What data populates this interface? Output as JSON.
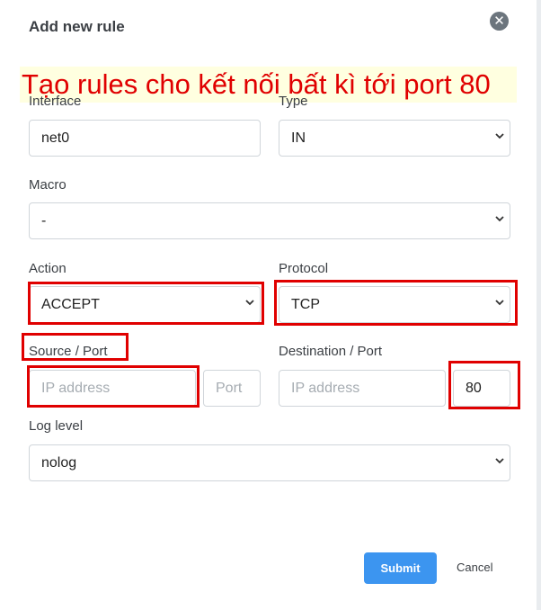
{
  "dialog": {
    "title": "Add new rule",
    "close_icon": "close-circle-icon"
  },
  "annotation": {
    "text": "Tạo rules cho kết nối bất kì tới port 80",
    "color": "#e00000"
  },
  "form": {
    "interface": {
      "label": "Interface",
      "value": "net0"
    },
    "type": {
      "label": "Type",
      "value": "IN"
    },
    "macro": {
      "label": "Macro",
      "value": "-"
    },
    "action": {
      "label": "Action",
      "value": "ACCEPT"
    },
    "protocol": {
      "label": "Protocol",
      "value": "TCP"
    },
    "source": {
      "label": "Source / Port",
      "ip_placeholder": "IP address",
      "port_placeholder": "Port"
    },
    "destination": {
      "label": "Destination / Port",
      "ip_placeholder": "IP address",
      "port_value": "80"
    },
    "log_level": {
      "label": "Log level",
      "value": "nolog"
    }
  },
  "buttons": {
    "submit": "Submit",
    "cancel": "Cancel",
    "submit_color": "#3c95f0"
  },
  "highlight_color": "#e00000"
}
